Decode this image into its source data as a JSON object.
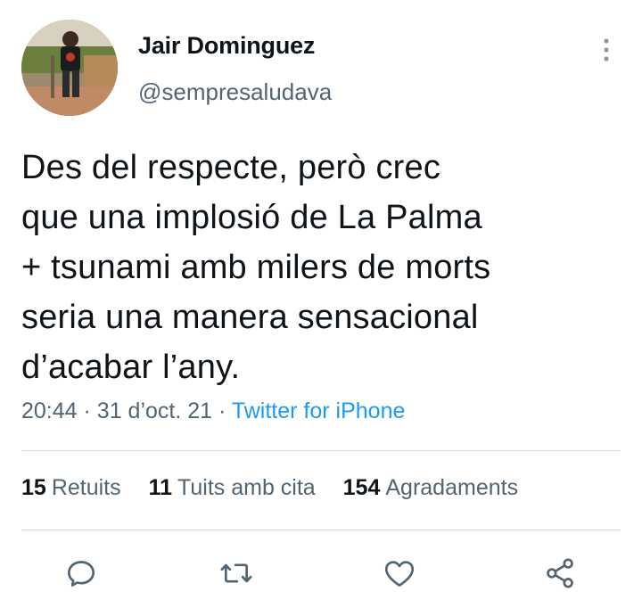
{
  "author": {
    "display_name": "Jair Dominguez",
    "handle": "@sempresaludava",
    "avatar_icon": "profile-photo"
  },
  "tweet": {
    "lines": [
      "Des del respecte, però crec",
      "que una implosió de La Palma",
      "+ tsunami amb milers de morts",
      "seria una manera sensacional",
      "d’acabar l’any."
    ],
    "time": "20:44",
    "date": "31 d’oct. 21",
    "source": "Twitter for iPhone",
    "separator": "·"
  },
  "stats": {
    "retweets_count": "15",
    "retweets_label": "Retuits",
    "quotes_count": "11",
    "quotes_label": "Tuits amb cita",
    "likes_count": "154",
    "likes_label": "Agradaments"
  },
  "actions": {
    "reply_icon": "reply-icon",
    "retweet_icon": "retweet-icon",
    "like_icon": "heart-icon",
    "share_icon": "share-icon",
    "more_icon": "more-vertical-icon"
  },
  "colors": {
    "text": "#0f1419",
    "secondary": "#536471",
    "link": "#1d9bf0",
    "divider": "#cfd9de"
  }
}
